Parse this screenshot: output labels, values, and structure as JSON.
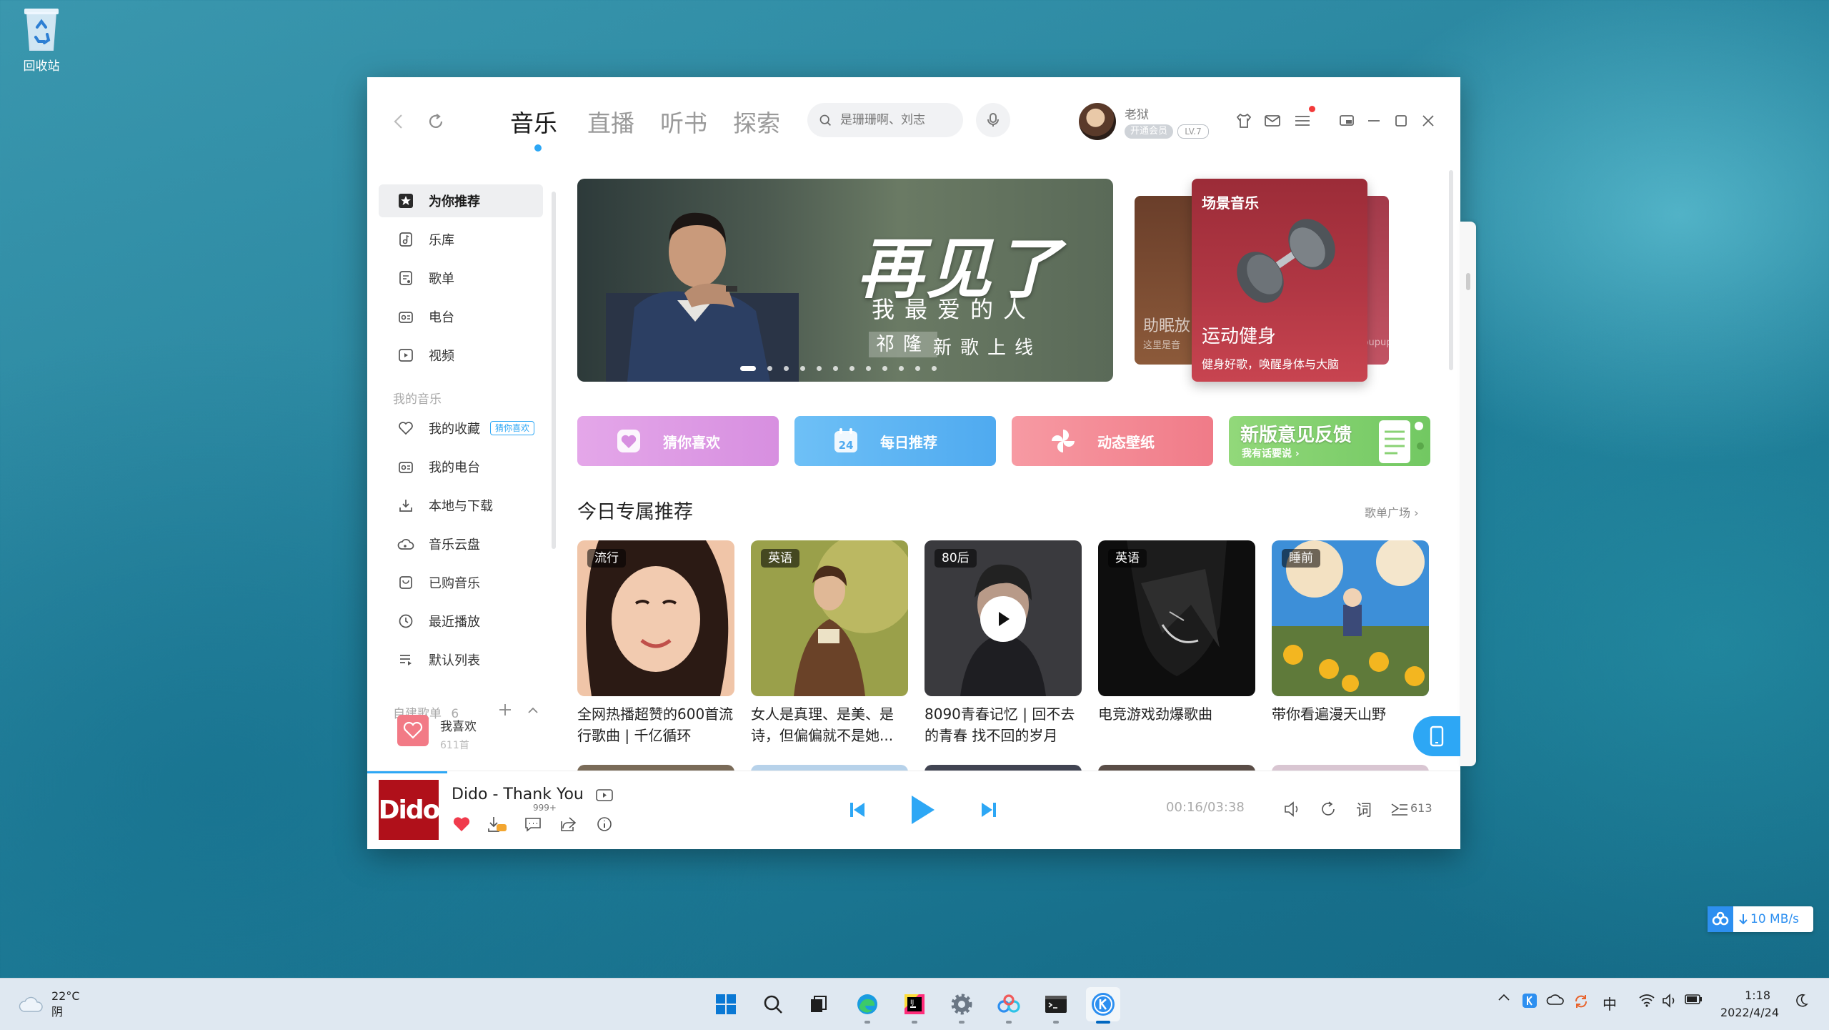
{
  "desktop": {
    "recycle_bin_label": "回收站"
  },
  "header": {
    "tabs": [
      {
        "label": "音乐",
        "active": true
      },
      {
        "label": "直播",
        "active": false
      },
      {
        "label": "听书",
        "active": false
      },
      {
        "label": "探索",
        "active": false
      }
    ],
    "search_placeholder": "是珊珊啊、刘志",
    "user": {
      "name": "老狱",
      "vip_badge": "开通会员",
      "level": "LV.7"
    }
  },
  "sidebar": {
    "items": [
      {
        "label": "为你推荐",
        "icon": "star-icon",
        "active": true
      },
      {
        "label": "乐库",
        "icon": "music-library-icon"
      },
      {
        "label": "歌单",
        "icon": "playlist-icon"
      },
      {
        "label": "电台",
        "icon": "radio-icon"
      },
      {
        "label": "视频",
        "icon": "video-icon"
      }
    ],
    "my_music_title": "我的音乐",
    "my_music": [
      {
        "label": "我的收藏",
        "icon": "heart-icon",
        "tag": "猜你喜欢"
      },
      {
        "label": "我的电台",
        "icon": "radio-icon"
      },
      {
        "label": "本地与下载",
        "icon": "download-icon"
      },
      {
        "label": "音乐云盘",
        "icon": "cloud-disk-icon"
      },
      {
        "label": "已购音乐",
        "icon": "purchased-icon"
      },
      {
        "label": "最近播放",
        "icon": "clock-icon"
      },
      {
        "label": "默认列表",
        "icon": "list-icon"
      }
    ],
    "created_playlists_title": "自建歌单",
    "created_playlists_count": "6",
    "playlist": {
      "name": "我喜欢",
      "count": "611首"
    }
  },
  "banner": {
    "title": "再见了",
    "subtitle": "我最爱的人",
    "artist": "祁隆",
    "tagline": "新歌上线",
    "dot_count": 12,
    "active_dot": 0
  },
  "scene": {
    "title": "场景音乐",
    "name": "运动健身",
    "desc": "健身好歌，唤醒身体与大脑",
    "left_label": "助眠放",
    "left_sub": "这里是音",
    "right_sub": "@upupup"
  },
  "quick_buttons": [
    {
      "label": "猜你喜欢",
      "icon": "heart-icon",
      "color": "#d79be3"
    },
    {
      "label": "每日推荐",
      "icon": "calendar-icon",
      "day": "24",
      "color": "#5fb4f0"
    },
    {
      "label": "动态壁纸",
      "icon": "pinwheel-icon",
      "color": "#f4848f"
    }
  ],
  "feedback": {
    "title": "新版意见反馈",
    "sub": "我有话要说 ›"
  },
  "section": {
    "title": "今日专属推荐",
    "more": "歌单广场 ›"
  },
  "cards": [
    {
      "tag": "流行",
      "title": "全网热播超赞的600首流行歌曲 | 千亿循环"
    },
    {
      "tag": "英语",
      "title": "女人是真理、是美、是诗，但偏偏就不是她..."
    },
    {
      "tag": "80后",
      "title": "8090青春记忆 | 回不去的青春 找不回的岁月"
    },
    {
      "tag": "英语",
      "title": "电竞游戏劲爆歌曲"
    },
    {
      "tag": "睡前",
      "title": "带你看遍漫天山野"
    }
  ],
  "player": {
    "song": "Dido - Thank You",
    "cover_text": "Dido",
    "comments": "999+",
    "time": "00:16/03:38",
    "lyrics_label": "词",
    "playlist_count": "613",
    "progress": 0.073
  },
  "speed_widget": {
    "value": "10 MB/s"
  },
  "taskbar": {
    "weather": {
      "temp": "22°C",
      "desc": "阴"
    },
    "ime": "中",
    "time": "1:18",
    "date": "2022/4/24"
  }
}
